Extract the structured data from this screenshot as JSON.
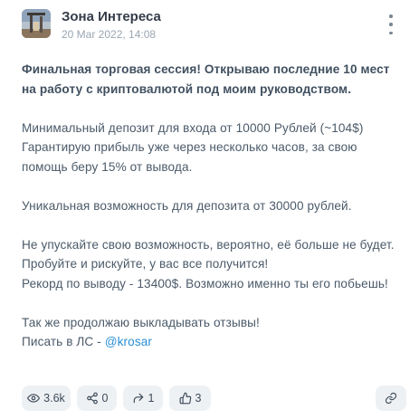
{
  "post": {
    "channel_name": "Зона Интереса",
    "date": "20 Mar 2022, 14:08",
    "lines_bold": [
      "Финальная торговая сессия! Открываю последние 10 мест",
      "на работу с криптовалютой под моим руководством."
    ],
    "para2": [
      "Минимальный депозит для входа от 10000 Рублей (~104$)",
      "Гарантирую прибыль уже через несколько часов, за свою",
      "помощь беру 15% от вывода."
    ],
    "para3": [
      "Уникальная возможность для депозита от 30000 рублей."
    ],
    "para4": [
      "Не упускайте свою возможность, вероятно, её больше не будет.",
      "Пробуйте и рискуйте, у вас все получится!",
      "Рекорд по выводу - 13400$. Возможно именно ты его побьешь!"
    ],
    "para5_line1": "Так же продолжаю выкладывать отзывы!",
    "para5_prefix": "Писать в ЛС - ",
    "para5_link": "@krosar"
  },
  "footer": {
    "views": "3.6k",
    "shares": "0",
    "reposts": "1",
    "likes": "3"
  },
  "icons": {
    "views": "eye-icon",
    "shares": "share-icon",
    "reposts": "repost-arrow-icon",
    "likes": "thumbs-up-icon",
    "link": "link-icon",
    "menu": "more-vertical-icon"
  },
  "colors": {
    "link": "#2b8fd6",
    "button_bg": "#eef1f4",
    "text": "#4b5a69"
  }
}
